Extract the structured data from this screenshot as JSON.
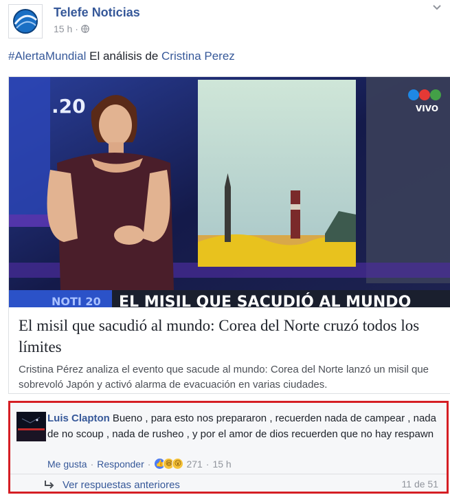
{
  "post": {
    "page_name": "Telefe Noticias",
    "time": "15 h",
    "dot": "·",
    "hashtag": "#AlertaMundial",
    "text_middle": " El análisis de ",
    "mention": "Cristina Perez"
  },
  "video": {
    "channel_number": ".20",
    "live_label": "VIVO",
    "lower_third": "NOTI 20",
    "headline_banner": "EL MISIL QUE SACUDIÓ AL MUNDO"
  },
  "card": {
    "title": "El misil que sacudió al mundo: Corea del Norte cruzó todos los límites",
    "description": "Cristina Pérez analiza el evento que sacude al mundo: Corea del Norte lanzó un misil que sobrevoló Japón y activó alarma de evacuación en varias ciudades."
  },
  "comment": {
    "author": "Luis Clapton",
    "text": "Bueno , para esto nos prepararon , recuerden nada de campear , nada de no scoup , nada de rusheo , y por el amor de dios recuerden que no hay respawn",
    "like_label": "Me gusta",
    "reply_label": "Responder",
    "separator": "·",
    "reaction_count": "271",
    "time": "15 h",
    "reactions": [
      "like-icon",
      "haha-icon",
      "wow-icon"
    ]
  },
  "replies": {
    "link_label": "Ver respuestas anteriores",
    "count_label": "11 de 51"
  },
  "colors": {
    "link": "#365899",
    "highlight_border": "#d51e24",
    "meta": "#90949c"
  }
}
